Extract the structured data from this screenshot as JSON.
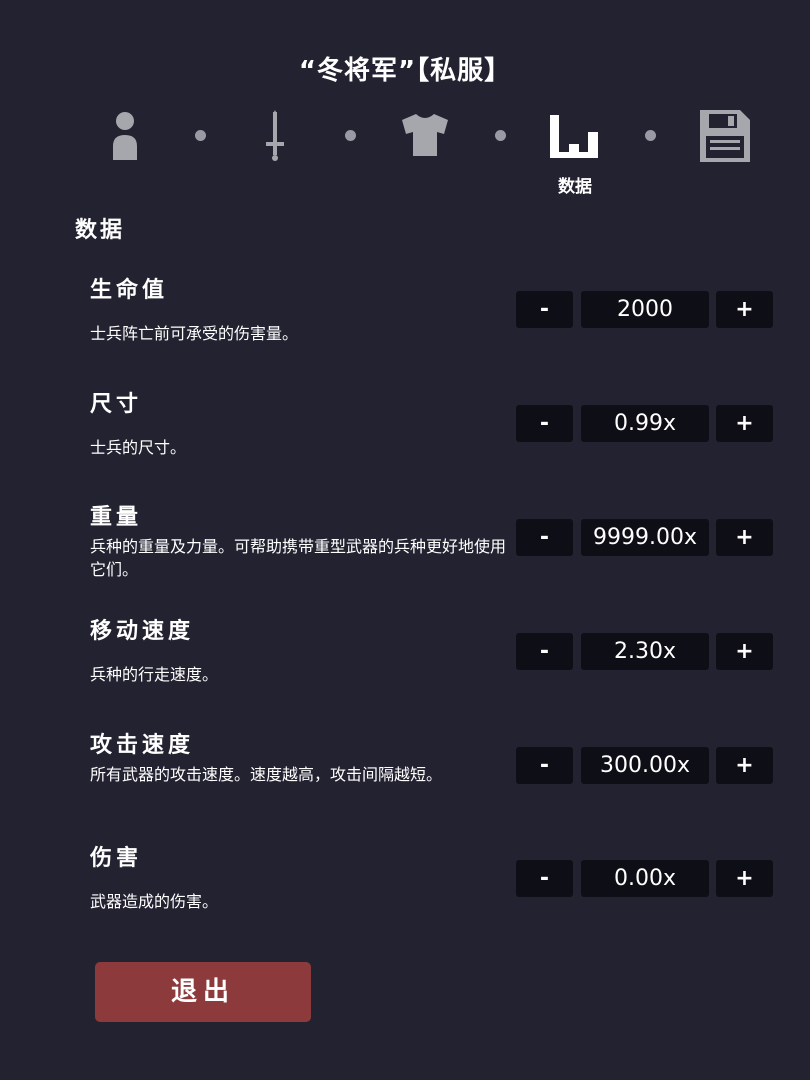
{
  "header": {
    "title": "“冬将军”【私服】"
  },
  "steps": [
    {
      "icon": "person-icon",
      "label": "",
      "active": false
    },
    {
      "icon": "sword-icon",
      "label": "",
      "active": false
    },
    {
      "icon": "shirt-icon",
      "label": "",
      "active": false
    },
    {
      "icon": "stats-chart-icon",
      "label": "数据",
      "active": true
    },
    {
      "icon": "floppy-save-icon",
      "label": "",
      "active": false
    }
  ],
  "section": {
    "title": "数据"
  },
  "stats": [
    {
      "name": "生命值",
      "desc": "士兵阵亡前可承受的伤害量。",
      "value": "2000",
      "minus": "-",
      "plus": "+"
    },
    {
      "name": "尺寸",
      "desc": "士兵的尺寸。",
      "value": "0.99x",
      "minus": "-",
      "plus": "+"
    },
    {
      "name": "重量",
      "desc": "兵种的重量及力量。可帮助携带重型武器的兵种更好地使用它们。",
      "value": "9999.00x",
      "minus": "-",
      "plus": "+"
    },
    {
      "name": "移动速度",
      "desc": "兵种的行走速度。",
      "value": "2.30x",
      "minus": "-",
      "plus": "+"
    },
    {
      "name": "攻击速度",
      "desc": "所有武器的攻击速度。速度越高，攻击间隔越短。",
      "value": "300.00x",
      "minus": "-",
      "plus": "+"
    },
    {
      "name": "伤害",
      "desc": "武器造成的伤害。",
      "value": "0.00x",
      "minus": "-",
      "plus": "+"
    }
  ],
  "footer": {
    "exit_label": "退出"
  },
  "colors": {
    "background": "#222231",
    "button_bg": "#0e0e16",
    "exit_bg": "#8c3a3c",
    "icon_inactive": "#a6a6ad",
    "icon_active": "#ffffff"
  }
}
